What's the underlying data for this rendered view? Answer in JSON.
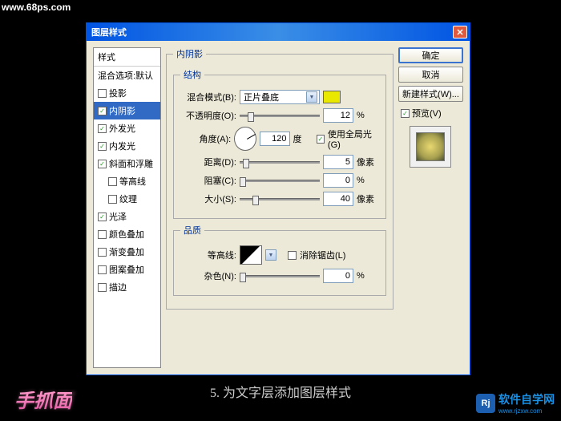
{
  "watermark_url": "www.68ps.com",
  "dialog": {
    "title": "图层样式",
    "styles_header": "样式",
    "blend_default": "混合选项:默认",
    "items": [
      {
        "label": "投影",
        "checked": false,
        "active": false
      },
      {
        "label": "内阴影",
        "checked": true,
        "active": true
      },
      {
        "label": "外发光",
        "checked": true,
        "active": false
      },
      {
        "label": "内发光",
        "checked": true,
        "active": false
      },
      {
        "label": "斜面和浮雕",
        "checked": true,
        "active": false
      },
      {
        "label": "等高线",
        "checked": false,
        "active": false,
        "sub": true
      },
      {
        "label": "纹理",
        "checked": false,
        "active": false,
        "sub": true
      },
      {
        "label": "光泽",
        "checked": true,
        "active": false
      },
      {
        "label": "颜色叠加",
        "checked": false,
        "active": false
      },
      {
        "label": "渐变叠加",
        "checked": false,
        "active": false
      },
      {
        "label": "图案叠加",
        "checked": false,
        "active": false
      },
      {
        "label": "描边",
        "checked": false,
        "active": false
      }
    ]
  },
  "panel": {
    "title": "内阴影",
    "structure_title": "结构",
    "blend_mode_label": "混合模式(B):",
    "blend_mode_value": "正片叠底",
    "opacity_label": "不透明度(O):",
    "opacity_value": "12",
    "percent": "%",
    "angle_label": "角度(A):",
    "angle_value": "120",
    "degree": "度",
    "use_global": "使用全局光(G)",
    "distance_label": "距离(D):",
    "distance_value": "5",
    "px": "像素",
    "choke_label": "阻塞(C):",
    "choke_value": "0",
    "size_label": "大小(S):",
    "size_value": "40",
    "quality_title": "品质",
    "contour_label": "等高线:",
    "antialias": "消除锯齿(L)",
    "noise_label": "杂色(N):",
    "noise_value": "0"
  },
  "buttons": {
    "ok": "确定",
    "cancel": "取消",
    "new_style": "新建样式(W)...",
    "preview": "预览(V)"
  },
  "caption": "5. 为文字层添加图层样式",
  "logo_left": "手抓面",
  "logo_right_text": "软件自学网",
  "logo_right_url": "www.rjzxw.com",
  "logo_right_icon": "Rj"
}
